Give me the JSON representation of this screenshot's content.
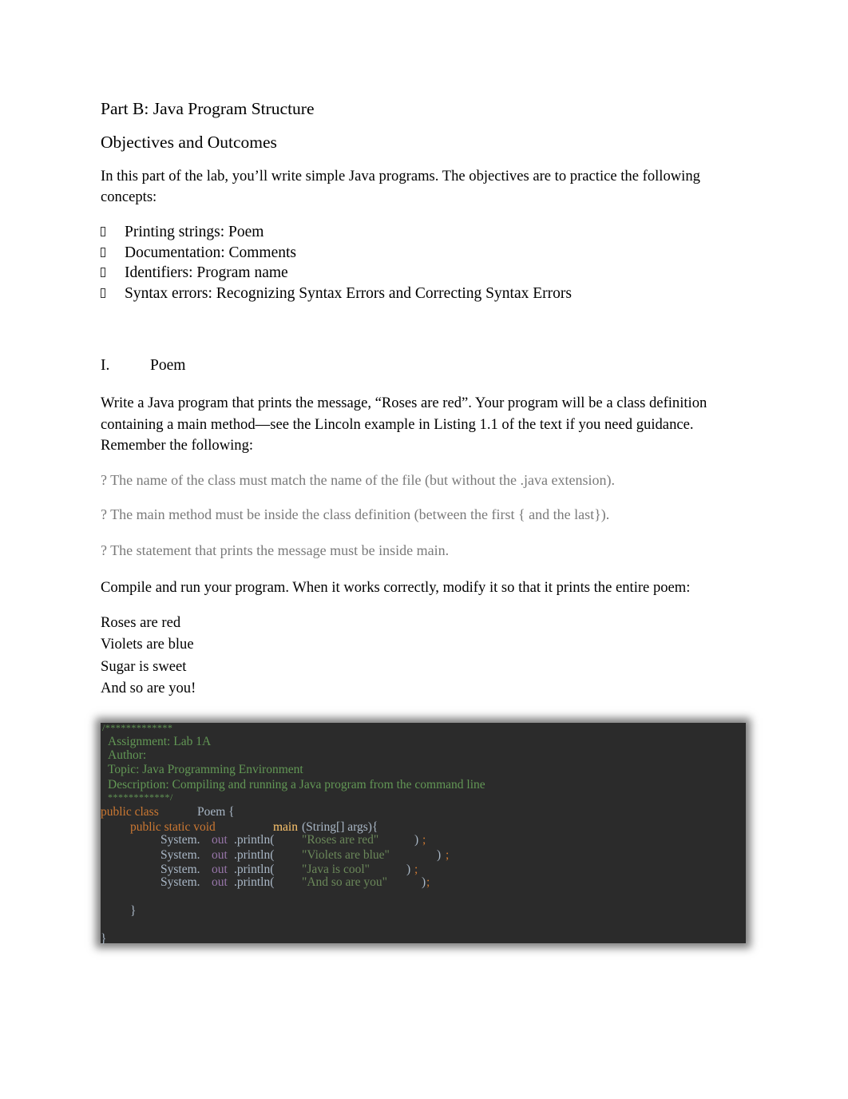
{
  "document": {
    "title": "Part B: Java Program Structure",
    "subtitle": "Objectives and Outcomes",
    "intro": "In this part of the lab, you’ll write simple Java programs. The objectives are to practice the following concepts:",
    "bullet_icon": "missing-glyph-box",
    "objectives": [
      "Printing strings: Poem",
      "Documentation: Comments",
      "Identifiers: Program name",
      "Syntax errors: Recognizing Syntax Errors and Correcting Syntax Errors"
    ],
    "section": {
      "number": "I.",
      "name": "Poem"
    },
    "instructions": "Write a Java program that prints the message, “Roses are red”. Your program will be a class definition containing a main method—see the Lincoln example in Listing 1.1 of the text if you need guidance. Remember the following:",
    "reminders": [
      "? The name of the class must match the name of the file (but without the .java extension).",
      "? The main method must be inside the class definition (between the first { and the last}).",
      "? The statement that prints the message must be inside main."
    ],
    "compile_note": "Compile and run your program. When it works correctly, modify it so that it prints the entire poem:",
    "poem_lines": [
      "Roses are red",
      "Violets are blue",
      "Sugar is sweet",
      "And so are you!"
    ]
  },
  "code": {
    "comment_open": "/*************",
    "comment_lines": [
      "Assignment: Lab 1A",
      "Author:",
      "Topic: Java Programming Environment",
      "Description: Compiling and running a Java program from the command line"
    ],
    "comment_close": "************/",
    "class_keywords": "public class",
    "class_name": "Poem {",
    "method_keywords": "public static void",
    "method_name": "main",
    "method_params": "(String[] args){",
    "statements": [
      {
        "system": "System.",
        "out": "out",
        "println": ".println(",
        "string": "\"Roses are red\"",
        "close": ")",
        "semi": ";"
      },
      {
        "system": "System.",
        "out": "out",
        "println": ".println(",
        "string": "\"Violets are blue\"",
        "close": ")",
        "semi": ";"
      },
      {
        "system": "System.",
        "out": "out",
        "println": ".println(",
        "string": "\"Java is cool\"",
        "close": ")",
        "semi": ";"
      },
      {
        "system": "System.",
        "out": "out",
        "println": ".println(",
        "string": "\"And so are you\"",
        "close": ")",
        "semi": ";"
      }
    ],
    "method_close": "}",
    "class_close": "}",
    "colors": {
      "background": "#2b2b2b",
      "comment": "#629755",
      "keyword": "#cc7832",
      "plain": "#a9b7c6",
      "method": "#ffc66d",
      "field": "#9876aa",
      "string": "#6a8759"
    }
  }
}
